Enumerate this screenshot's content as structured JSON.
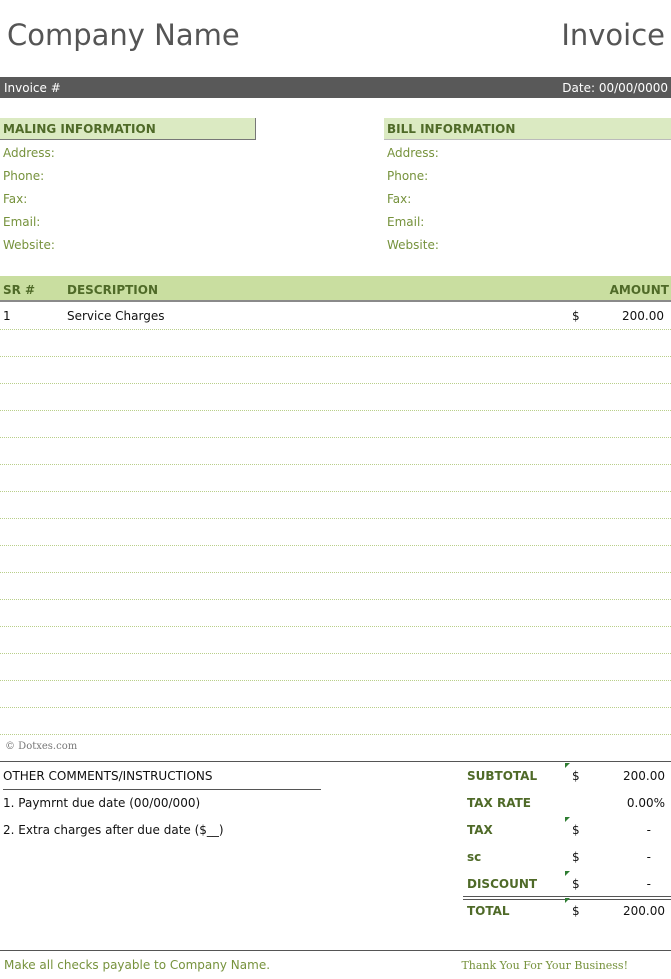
{
  "header": {
    "company_name": "Company Name",
    "doc_title": "Invoice"
  },
  "band": {
    "invoice_label": "Invoice #",
    "date_label": "Date: 00/00/0000"
  },
  "mailing": {
    "title": "MALING INFORMATION",
    "fields": [
      "Address:",
      "Phone:",
      "Fax:",
      "Email:",
      "Website:"
    ]
  },
  "billing": {
    "title": "BILL INFORMATION",
    "fields": [
      "Address:",
      "Phone:",
      "Fax:",
      "Email:",
      "Website:"
    ]
  },
  "table": {
    "col_sr": "SR #",
    "col_desc": "DESCRIPTION",
    "col_amount": "AMOUNT",
    "rows": [
      {
        "sr": "1",
        "desc": "Service Charges",
        "cur": "$",
        "amount": "200.00"
      },
      {
        "sr": "",
        "desc": "",
        "cur": "",
        "amount": ""
      },
      {
        "sr": "",
        "desc": "",
        "cur": "",
        "amount": ""
      },
      {
        "sr": "",
        "desc": "",
        "cur": "",
        "amount": ""
      },
      {
        "sr": "",
        "desc": "",
        "cur": "",
        "amount": ""
      },
      {
        "sr": "",
        "desc": "",
        "cur": "",
        "amount": ""
      },
      {
        "sr": "",
        "desc": "",
        "cur": "",
        "amount": ""
      },
      {
        "sr": "",
        "desc": "",
        "cur": "",
        "amount": ""
      },
      {
        "sr": "",
        "desc": "",
        "cur": "",
        "amount": ""
      },
      {
        "sr": "",
        "desc": "",
        "cur": "",
        "amount": ""
      },
      {
        "sr": "",
        "desc": "",
        "cur": "",
        "amount": ""
      },
      {
        "sr": "",
        "desc": "",
        "cur": "",
        "amount": ""
      },
      {
        "sr": "",
        "desc": "",
        "cur": "",
        "amount": ""
      },
      {
        "sr": "",
        "desc": "",
        "cur": "",
        "amount": ""
      },
      {
        "sr": "",
        "desc": "",
        "cur": "",
        "amount": ""
      },
      {
        "sr": "",
        "desc": "",
        "cur": "",
        "amount": ""
      }
    ]
  },
  "watermark": "© Dotxes.com",
  "comments": {
    "title": "OTHER COMMENTS/INSTRUCTIONS",
    "items": [
      "1. Paymrnt due date (00/00/000)",
      "2. Extra charges after due date ($__)"
    ]
  },
  "totals": {
    "subtotal": {
      "label": "SUBTOTAL",
      "cur": "$",
      "value": "200.00"
    },
    "tax_rate": {
      "label": "TAX RATE",
      "cur": "",
      "value": "0.00%"
    },
    "tax": {
      "label": "TAX",
      "cur": "$",
      "value": "-"
    },
    "sc": {
      "label": "sc",
      "cur": "$",
      "value": "-"
    },
    "discount": {
      "label": "DISCOUNT",
      "cur": "$",
      "value": "-"
    },
    "total": {
      "label": "TOTAL",
      "cur": "$",
      "value": "200.00"
    }
  },
  "footer": {
    "left": "Make all checks payable to Company Name.",
    "right": "Thank You For Your Business!"
  },
  "colors": {
    "accent_green": "#76923c",
    "header_fill": "#c9dea0",
    "band_gray": "#595959"
  }
}
